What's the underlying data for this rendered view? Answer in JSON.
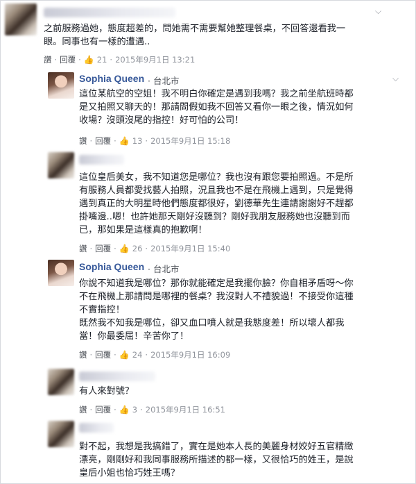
{
  "comments": [
    {
      "name": "",
      "location": "",
      "text": "之前服務過她，態度超差的，問她需不需要幫她整理餐桌，不回答還看我一\n眼。同事也有一樣的遭遇..",
      "reply_label": "讚",
      "reply_link": "回覆",
      "likes": "21",
      "date": "2015年9月1日 13:21"
    },
    {
      "name": "Sophia Queen",
      "location": "台北市",
      "text": "這位某航空的空姐！我不明白你確定是遇到我嗎？我之前坐航班時都\n是又拍照又聊天的！那請問假如我不回答又看你一眼之後，情況如何\n收場？沒頭沒尾的指控！好可怕的公司！",
      "reply_label": "讚",
      "reply_link": "回覆",
      "likes": "13",
      "date": "2015年9月1日 15:18"
    },
    {
      "name": "",
      "location": "",
      "text": "這位皇后美女，我不知道您是哪位？我也沒有跟您要拍照過。不是所\n有服務人員都愛找藝人拍照，況且我也不是在飛機上遇到，只是覺得\n遇到真正的大明星時他們態度都很好，劉德華先生連請謝謝好不趕都\n掛嘴邊..嗯！也許她那天剛好沒聽到？剛好我朋友服務她也沒聽到而\n已，那如果是這樣真的抱歉啊！",
      "reply_label": "讚",
      "reply_link": "回覆",
      "likes": "26",
      "date": "2015年9月1日 15:40"
    },
    {
      "name": "Sophia Queen",
      "location": "台北市",
      "text": "你說不知道我是哪位？那你就能確定是我擺你臉？你自相矛盾呀～你\n不在飛機上那請問是哪裡的餐桌？我沒對人不禮貌過！不接受你這種\n不實指控！\n既然我不知我是哪位，卻又血口噴人就是我態度差！所以壞人都我\n當！你最委屈！辛苦你了！",
      "reply_label": "讚",
      "reply_link": "回覆",
      "likes": "24",
      "date": "2015年9月1日 16:09"
    },
    {
      "name": "",
      "location": "",
      "text": "有人來對號？",
      "reply_label": "讚",
      "reply_link": "回覆",
      "likes": "3",
      "date": "2015年9月1日 16:51"
    },
    {
      "name": "",
      "location": "",
      "text": "對不起，我想是我搞錯了，實在是她本人長的美麗身材姣好五官精緻\n漂亮，剛剛好和我同事服務所描述的都一樣，又很恰巧的姓王，是說\n皇后小姐也恰巧姓王嗎？",
      "reply_label": "",
      "reply_link": "",
      "likes": "",
      "date": ""
    }
  ],
  "icons": {
    "like": "thumbs-up-icon",
    "menu": "chevron-down-icon"
  },
  "colors": {
    "name": "#365899",
    "meta": "#90949c",
    "like_icon": "#5b7bd5"
  }
}
